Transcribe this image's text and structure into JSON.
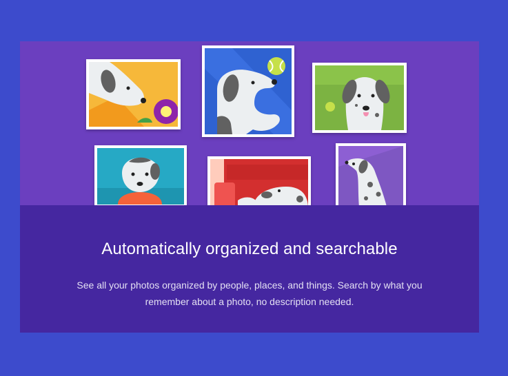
{
  "onboarding": {
    "headline": "Automatically organized and searchable",
    "body": "See all your photos organized by people, places, and things. Search by what you remember about a photo, no description needed."
  },
  "colors": {
    "page_background": "#3d4bcc",
    "card_background": "#6b3fbf",
    "caption_background": "#4527a0"
  },
  "illustration": {
    "photos": [
      {
        "subject": "dog-with-flower",
        "background": "#f6b83a"
      },
      {
        "subject": "dog-with-tennis-ball",
        "background": "#2f62d1"
      },
      {
        "subject": "dog-on-grass",
        "background": "#7cb342"
      },
      {
        "subject": "dog-on-teal",
        "background": "#26a9c5"
      },
      {
        "subject": "dog-on-red-couch",
        "background": "#d32f2f"
      },
      {
        "subject": "dog-on-purple",
        "background": "#8d5fd3"
      }
    ]
  }
}
